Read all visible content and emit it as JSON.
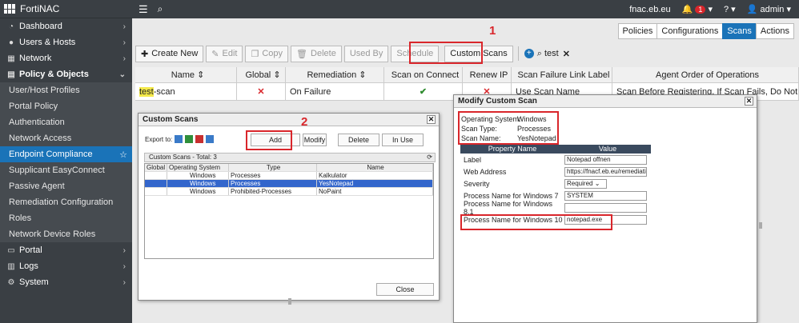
{
  "app": {
    "title": "FortiNAC"
  },
  "topbar": {
    "host": "fnac.eb.eu",
    "alert_count": "1",
    "user": "admin"
  },
  "sidebar": {
    "items": [
      {
        "label": "Dashboard",
        "icon": "dashboard-icon",
        "glyph": "◔",
        "chevron": "›",
        "bold": false,
        "sub": false
      },
      {
        "label": "Users & Hosts",
        "icon": "users-icon",
        "glyph": "●",
        "chevron": "›",
        "bold": false,
        "sub": false
      },
      {
        "label": "Network",
        "icon": "network-icon",
        "glyph": "▦",
        "chevron": "›",
        "bold": false,
        "sub": false
      },
      {
        "label": "Policy & Objects",
        "icon": "policy-icon",
        "glyph": "▤",
        "chevron": "⌄",
        "bold": true,
        "sub": false
      },
      {
        "label": "User/Host Profiles",
        "sub": true
      },
      {
        "label": "Portal Policy",
        "sub": true
      },
      {
        "label": "Authentication",
        "sub": true
      },
      {
        "label": "Network Access",
        "sub": true
      },
      {
        "label": "Endpoint Compliance",
        "sub": true,
        "active": true
      },
      {
        "label": "Supplicant EasyConnect",
        "sub": true
      },
      {
        "label": "Passive Agent",
        "sub": true
      },
      {
        "label": "Remediation Configuration",
        "sub": true
      },
      {
        "label": "Roles",
        "sub": true
      },
      {
        "label": "Network Device Roles",
        "sub": true
      },
      {
        "label": "Portal",
        "icon": "portal-icon",
        "glyph": "▭",
        "chevron": "›",
        "bold": false,
        "sub": false
      },
      {
        "label": "Logs",
        "icon": "logs-icon",
        "glyph": "▥",
        "chevron": "›",
        "bold": false,
        "sub": false
      },
      {
        "label": "System",
        "icon": "gear-icon",
        "glyph": "⚙",
        "chevron": "›",
        "bold": false,
        "sub": false
      }
    ]
  },
  "tabs": {
    "items": [
      "Policies",
      "Configurations",
      "Scans",
      "Actions"
    ],
    "active": "Scans"
  },
  "toolbar": {
    "create_new": "Create New",
    "edit": "Edit",
    "copy": "Copy",
    "delete": "Delete",
    "used_by": "Used By",
    "schedule": "Schedule",
    "custom_scans": "Custom Scans",
    "filter_value": "test"
  },
  "annotations": {
    "n1": "1",
    "n2": "2"
  },
  "grid": {
    "headers": [
      "Name",
      "Global",
      "Remediation",
      "Scan on Connect",
      "Renew IP",
      "Scan Failure Link Label",
      "Agent Order of Operations"
    ],
    "row": {
      "name_hl": "test",
      "name_rest": "-scan",
      "global": "✕",
      "remediation": "On Failure",
      "scan_on_connect": "✔",
      "renew_ip": "✕",
      "link_label": "Use Scan Name",
      "agent_order": "Scan Before Registering, If Scan Fails, Do Not Register"
    }
  },
  "custom_scans": {
    "title": "Custom Scans",
    "export_to": "Export to:",
    "add": "Add",
    "modify": "Modify",
    "delete": "Delete",
    "in_use": "In Use",
    "total": "Custom Scans - Total: 3",
    "headers": [
      "Global",
      "Operating System",
      "Type",
      "Name"
    ],
    "rows": [
      {
        "global": "",
        "os": "Windows",
        "type": "Processes",
        "name": "Kalkulator"
      },
      {
        "global": "",
        "os": "Windows",
        "type": "Processes",
        "name": "YesNotepad"
      },
      {
        "global": "",
        "os": "Windows",
        "type": "Prohibited-Processes",
        "name": "NoPaint"
      }
    ],
    "close": "Close"
  },
  "modify": {
    "title": "Modify Custom Scan",
    "os_label": "Operating System:",
    "os_value": "Windows",
    "type_label": "Scan Type:",
    "type_value": "Processes",
    "name_label": "Scan Name:",
    "name_value": "YesNotepad",
    "headers": [
      "Property Name",
      "Value"
    ],
    "props": [
      {
        "k": "Label",
        "v": "Notepad offnen"
      },
      {
        "k": "Web Address",
        "v": "https://fnacf.eb.eu/remediati"
      },
      {
        "k": "Severity",
        "v": "Required"
      },
      {
        "k": "Process Name for Windows 7",
        "v": "SYSTEM"
      },
      {
        "k": "Process Name for Windows 8.1",
        "v": ""
      },
      {
        "k": "Process Name for Windows 10",
        "v": "notepad.exe"
      }
    ]
  }
}
